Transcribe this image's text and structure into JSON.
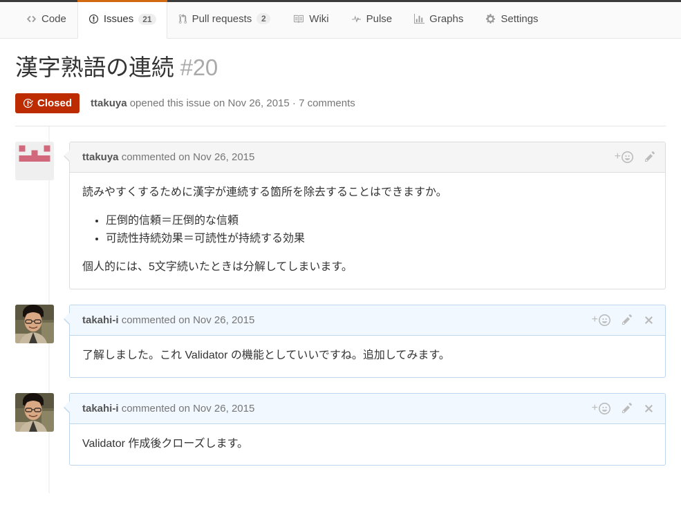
{
  "repo_nav": {
    "tabs": [
      {
        "label": "Code",
        "icon": "code-icon",
        "count": null,
        "selected": false
      },
      {
        "label": "Issues",
        "icon": "issue-opened-icon",
        "count": "21",
        "selected": true
      },
      {
        "label": "Pull requests",
        "icon": "git-pull-request-icon",
        "count": "2",
        "selected": false
      },
      {
        "label": "Wiki",
        "icon": "book-icon",
        "count": null,
        "selected": false
      },
      {
        "label": "Pulse",
        "icon": "pulse-icon",
        "count": null,
        "selected": false
      },
      {
        "label": "Graphs",
        "icon": "graph-icon",
        "count": null,
        "selected": false
      },
      {
        "label": "Settings",
        "icon": "gear-icon",
        "count": null,
        "selected": false
      }
    ]
  },
  "issue": {
    "title": "漢字熟語の連続",
    "number": "#20",
    "state_label": "Closed",
    "state_color": "#bd2c00",
    "author": "ttakuya",
    "meta_action": "opened this issue on",
    "meta_date": "Nov 26, 2015",
    "meta_separator": "·",
    "meta_comments": "7 comments"
  },
  "comments": [
    {
      "author": "ttakuya",
      "commented_text": "commented on",
      "date": "Nov 26, 2015",
      "own": false,
      "avatar": "identicon-avatar",
      "actions": [
        {
          "name": "add-reaction-button",
          "icon": "smiley-icon"
        },
        {
          "name": "edit-comment-button",
          "icon": "pencil-icon"
        }
      ],
      "body": {
        "paragraph_1": "読みやすくするために漢字が連続する箇所を除去することはできますか。",
        "list": [
          "圧倒的信頼＝圧倒的な信頼",
          "可読性持続効果＝可読性が持続する効果"
        ],
        "paragraph_2": "個人的には、5文字続いたときは分解してしまいます。"
      }
    },
    {
      "author": "takahi-i",
      "commented_text": "commented on",
      "date": "Nov 26, 2015",
      "own": true,
      "avatar": "photo-avatar",
      "actions": [
        {
          "name": "add-reaction-button",
          "icon": "smiley-icon"
        },
        {
          "name": "edit-comment-button",
          "icon": "pencil-icon"
        },
        {
          "name": "delete-comment-button",
          "icon": "x-icon"
        }
      ],
      "body": {
        "paragraph_1": "了解しました。これ Validator の機能としていいですね。追加してみます。"
      }
    },
    {
      "author": "takahi-i",
      "commented_text": "commented on",
      "date": "Nov 26, 2015",
      "own": true,
      "avatar": "photo-avatar",
      "actions": [
        {
          "name": "add-reaction-button",
          "icon": "smiley-icon"
        },
        {
          "name": "edit-comment-button",
          "icon": "pencil-icon"
        },
        {
          "name": "delete-comment-button",
          "icon": "x-icon"
        }
      ],
      "body": {
        "paragraph_1": "Validator 作成後クローズします。"
      }
    }
  ],
  "colors": {
    "accent_selected_tab": "#d26911",
    "closed_state": "#bd2c00",
    "own_comment_header": "#f1f8ff",
    "other_comment_header": "#f5f5f5"
  }
}
